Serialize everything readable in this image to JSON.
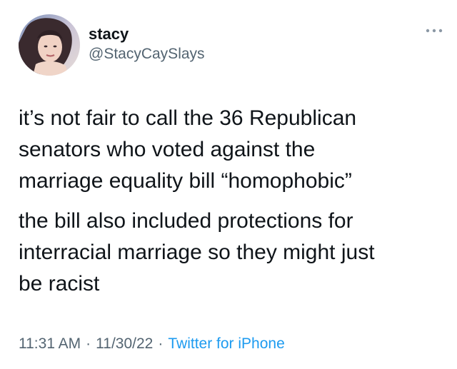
{
  "author": {
    "display_name": "stacy",
    "handle": "@StacyCaySlays",
    "avatar_icon": "profile-photo",
    "more_icon": "more-options-icon"
  },
  "tweet": {
    "paragraph1": [
      "it’s not fair to call the 36 Republican",
      "senators who voted against the",
      "marriage equality bill “homophobic”"
    ],
    "paragraph2": [
      "the bill also included protections for",
      "interracial marriage so they might just",
      "be racist"
    ]
  },
  "meta": {
    "time": "11:31 AM",
    "date": "11/30/22",
    "separator": "·",
    "source": "Twitter for iPhone"
  },
  "colors": {
    "text": "#0f1419",
    "secondary": "#536471",
    "link": "#1d9bf0"
  }
}
